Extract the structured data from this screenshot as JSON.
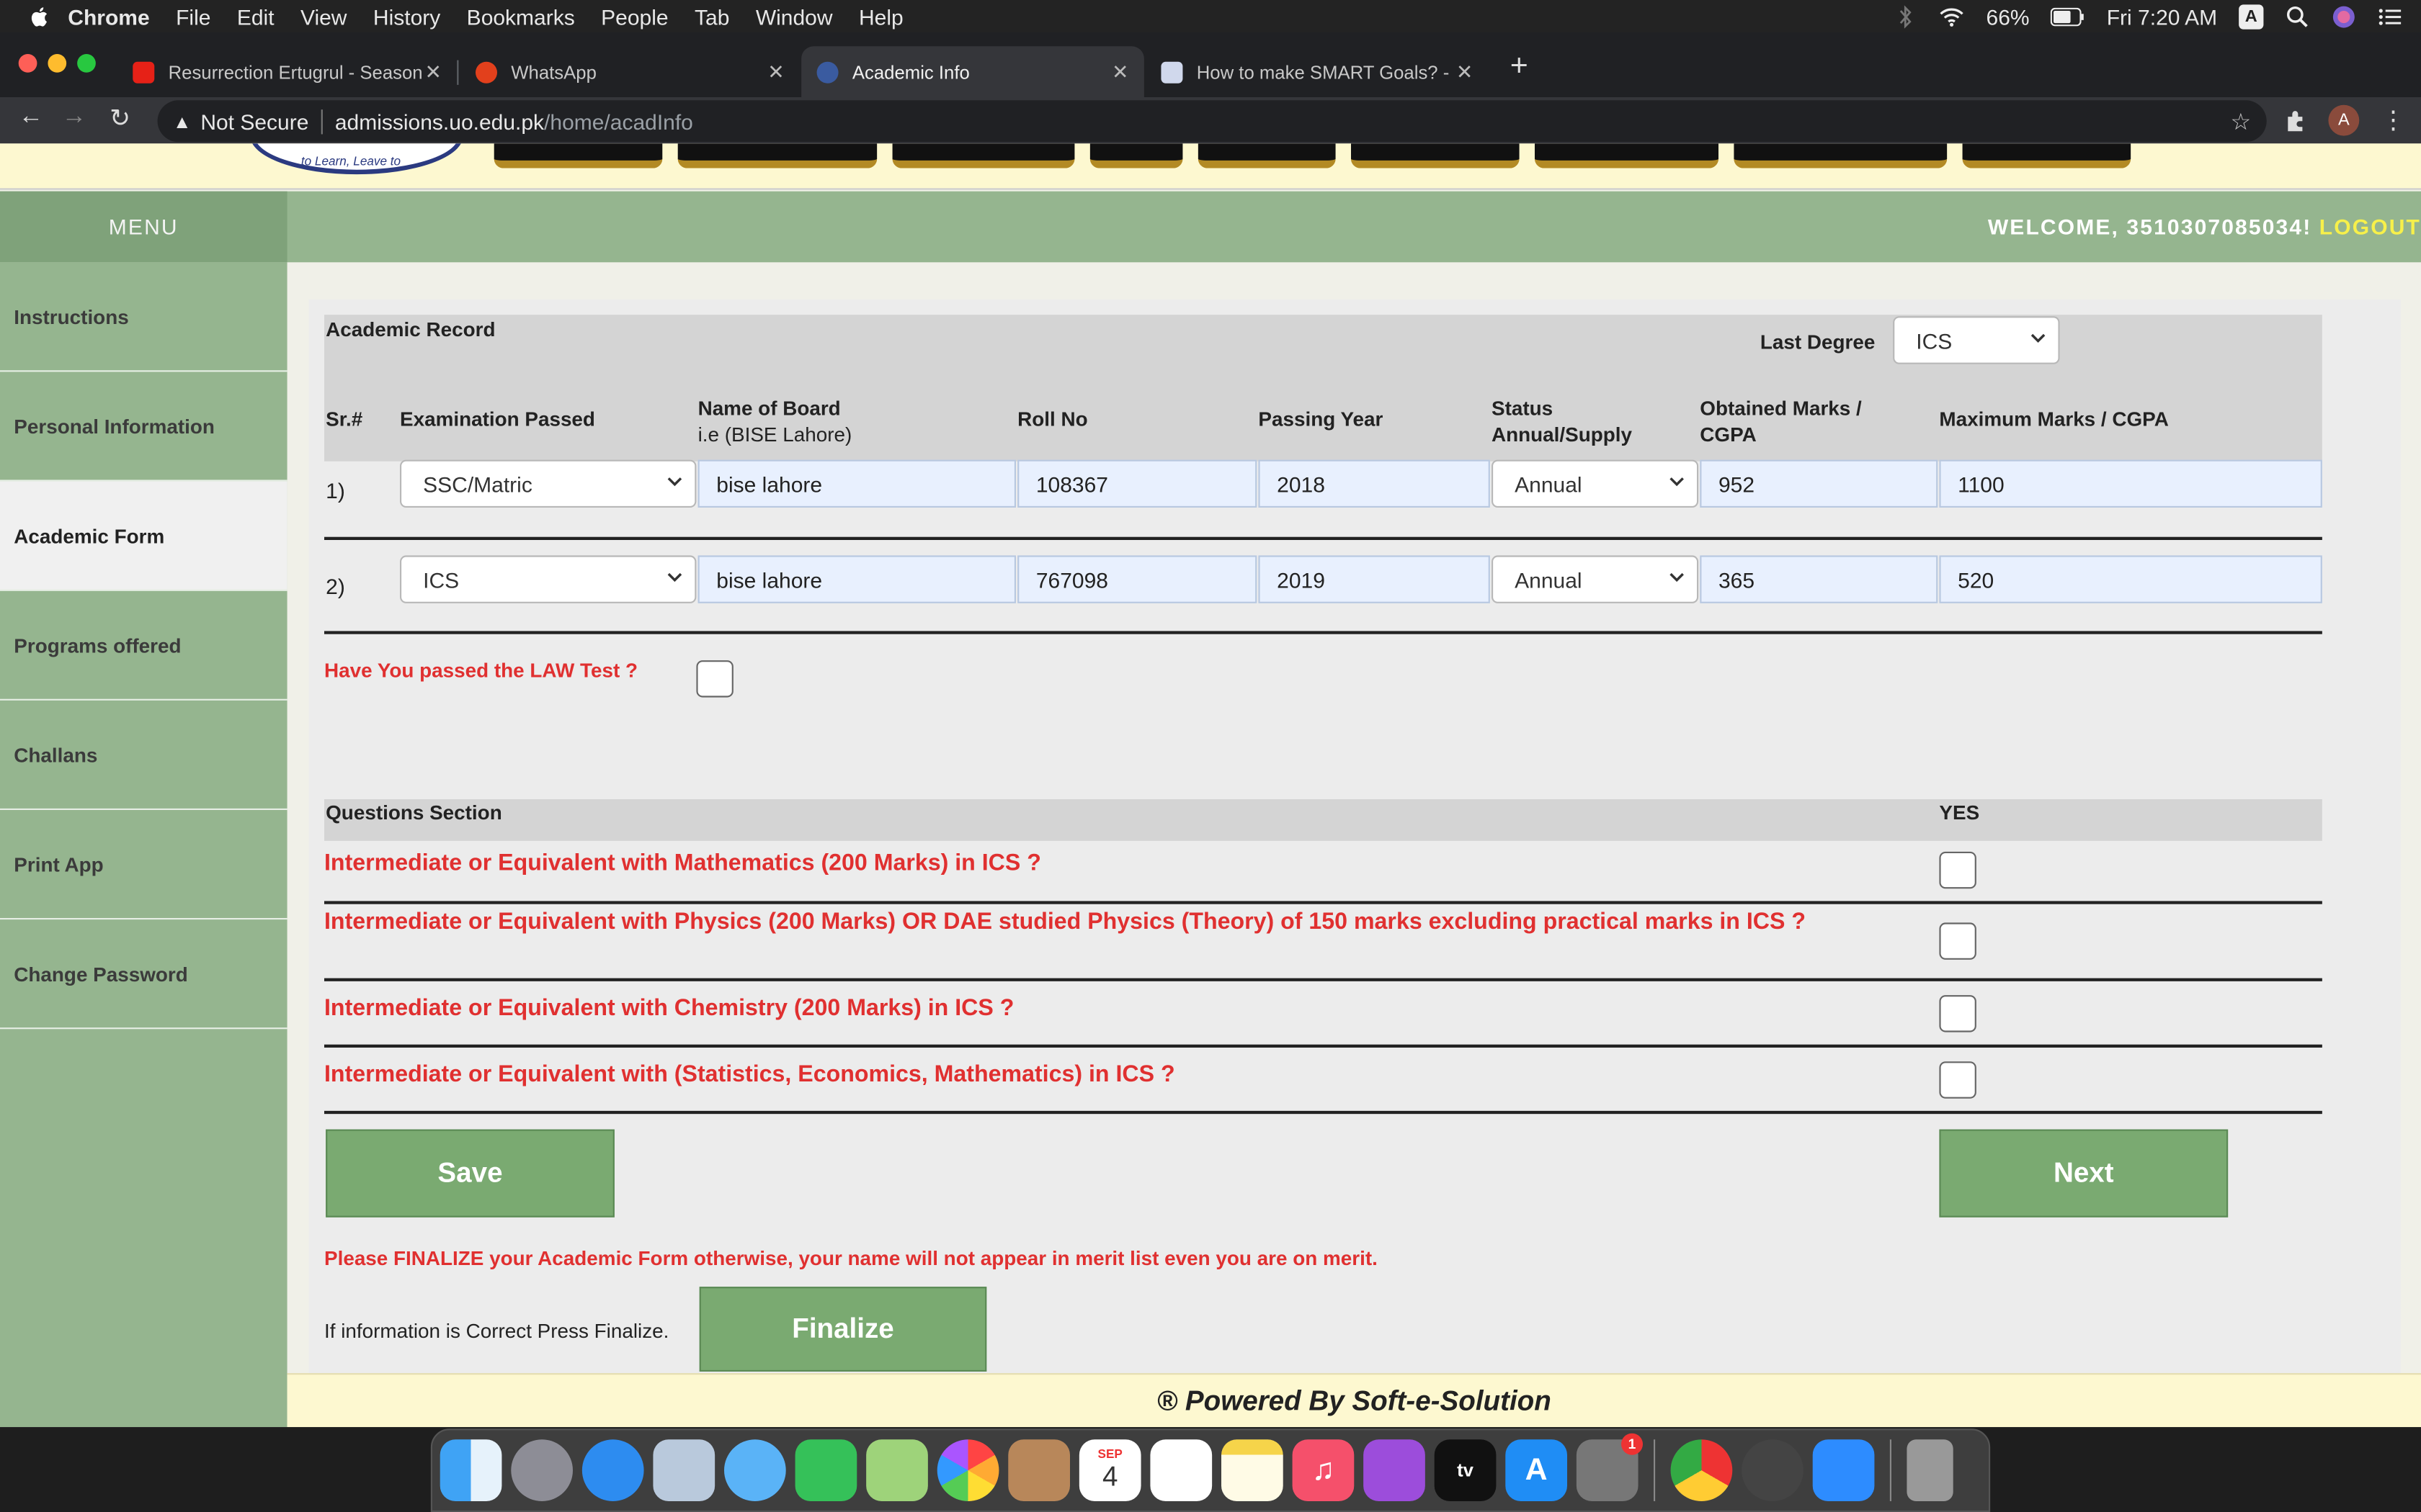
{
  "menubar": {
    "app": "Chrome",
    "items": [
      "File",
      "Edit",
      "View",
      "History",
      "Bookmarks",
      "People",
      "Tab",
      "Window",
      "Help"
    ],
    "battery": "66%",
    "clock": "Fri 7:20 AM",
    "input_source": "A"
  },
  "tabs": [
    {
      "title": "Resurrection Ertugrul - Season",
      "fav_color": "#e62117"
    },
    {
      "title": "WhatsApp",
      "fav_color": "#e2401c"
    },
    {
      "title": "Academic Info",
      "fav_color": "#3a5ba0"
    },
    {
      "title": "How to make SMART Goals? -",
      "fav_color": "#d0d8ec"
    }
  ],
  "omnibox": {
    "security": "Not Secure",
    "host": "admissions.uo.edu.pk",
    "path": "/home/acadInfo"
  },
  "profile_initial": "A",
  "header": {
    "banner_logo_text": "to Learn, Leave to",
    "menu_label": "MENU",
    "welcome": "WELCOME, 3510307085034!",
    "logout": "LOGOUT"
  },
  "sidebar": {
    "items": [
      {
        "label": "Instructions"
      },
      {
        "label": "Personal Information"
      },
      {
        "label": "Academic Form"
      },
      {
        "label": "Programs offered"
      },
      {
        "label": "Challans"
      },
      {
        "label": "Print App"
      },
      {
        "label": "Change Password"
      }
    ]
  },
  "academic": {
    "title": "Academic Record",
    "last_degree_label": "Last Degree",
    "last_degree_value": "ICS",
    "columns": {
      "sr": "Sr.#",
      "exam": "Examination Passed",
      "board": "Name of Board",
      "board_hint": "i.e (BISE Lahore)",
      "roll": "Roll No",
      "year": "Passing Year",
      "status_1": "Status",
      "status_2": "Annual/Supply",
      "obtained_1": "Obtained Marks /",
      "obtained_2": "CGPA",
      "max": "Maximum Marks / CGPA"
    },
    "rows": [
      {
        "sr": "1)",
        "exam": "SSC/Matric",
        "board": "bise lahore",
        "roll": "108367",
        "year": "2018",
        "status": "Annual",
        "obtained": "952",
        "max": "1100"
      },
      {
        "sr": "2)",
        "exam": "ICS",
        "board": "bise lahore",
        "roll": "767098",
        "year": "2019",
        "status": "Annual",
        "obtained": "365",
        "max": "520"
      }
    ],
    "law_question": "Have You passed the LAW Test ?"
  },
  "questions": {
    "header": "Questions Section",
    "yes_label": "YES",
    "items": [
      "Intermediate or Equivalent with Mathematics (200 Marks) in ICS ?",
      "Intermediate or Equivalent with Physics (200 Marks) OR DAE studied Physics (Theory) of 150 marks excluding practical marks in ICS ?",
      "Intermediate or Equivalent with Chemistry (200 Marks) in ICS ?",
      "Intermediate or Equivalent with (Statistics, Economics, Mathematics) in ICS ?"
    ]
  },
  "actions": {
    "save": "Save",
    "next": "Next",
    "notice": "Please FINALIZE your Academic Form otherwise, your name will not appear in merit list even you are on merit.",
    "finalize_hint": "If information is Correct Press Finalize.",
    "finalize": "Finalize"
  },
  "footer": "® Powered By Soft-e-Solution",
  "dock": {
    "calendar_month": "SEP",
    "calendar_day": "4",
    "tv_label": "tv",
    "settings_badge": "1"
  },
  "colors": {
    "green": "#95b58f",
    "button_green": "#7aaa71",
    "warning_red": "#e03030",
    "welcome_yellow": "#f7f04a"
  }
}
